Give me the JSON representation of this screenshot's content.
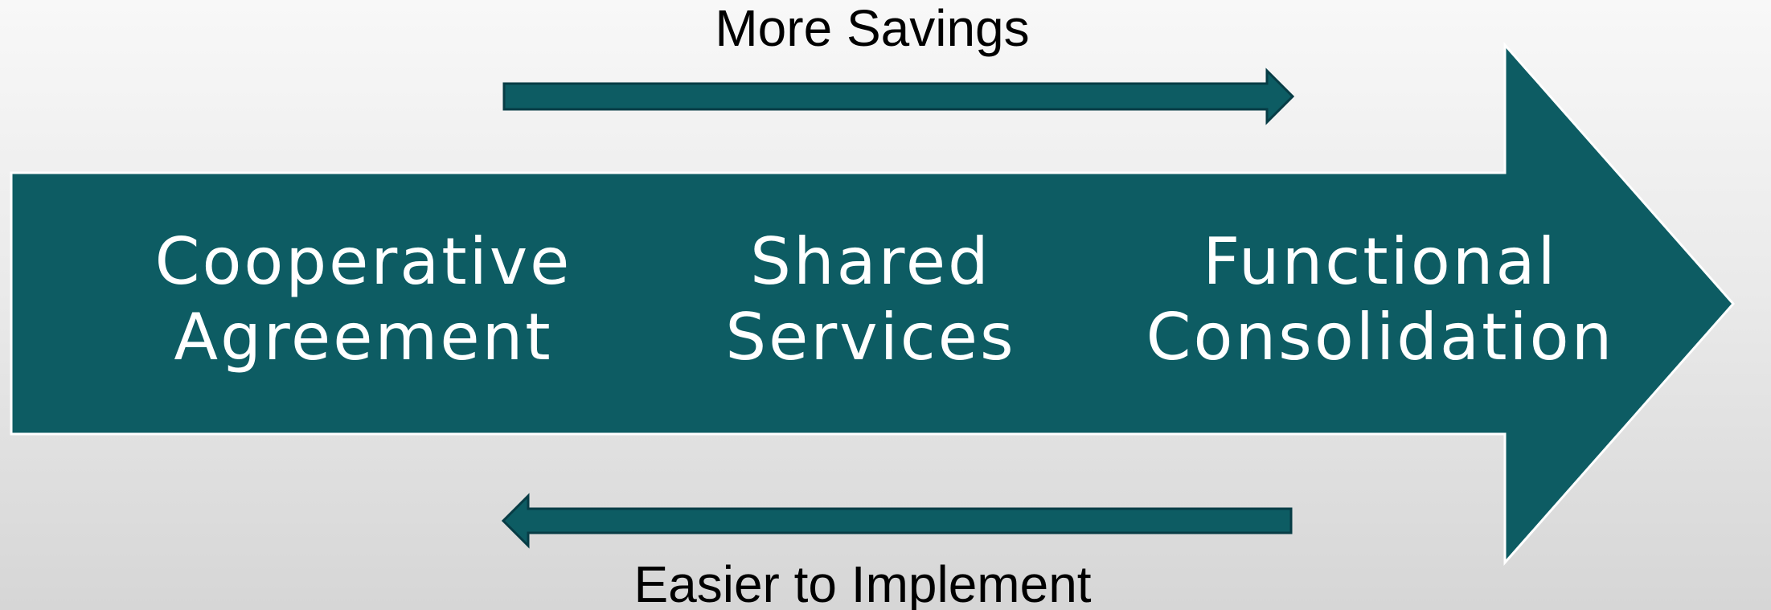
{
  "top_label": "More Savings",
  "bottom_label": "Easier to Implement",
  "stages": [
    {
      "line1": "Cooperative",
      "line2": "Agreement"
    },
    {
      "line1": "Shared",
      "line2": "Services"
    },
    {
      "line1": "Functional",
      "line2": "Consolidation"
    }
  ],
  "colors": {
    "arrow_fill": "#0d5c63",
    "arrow_outline": "#ffffff",
    "thin_arrow_stroke": "#073c45",
    "text_on_arrow": "#ffffff",
    "caption_text": "#000000"
  }
}
